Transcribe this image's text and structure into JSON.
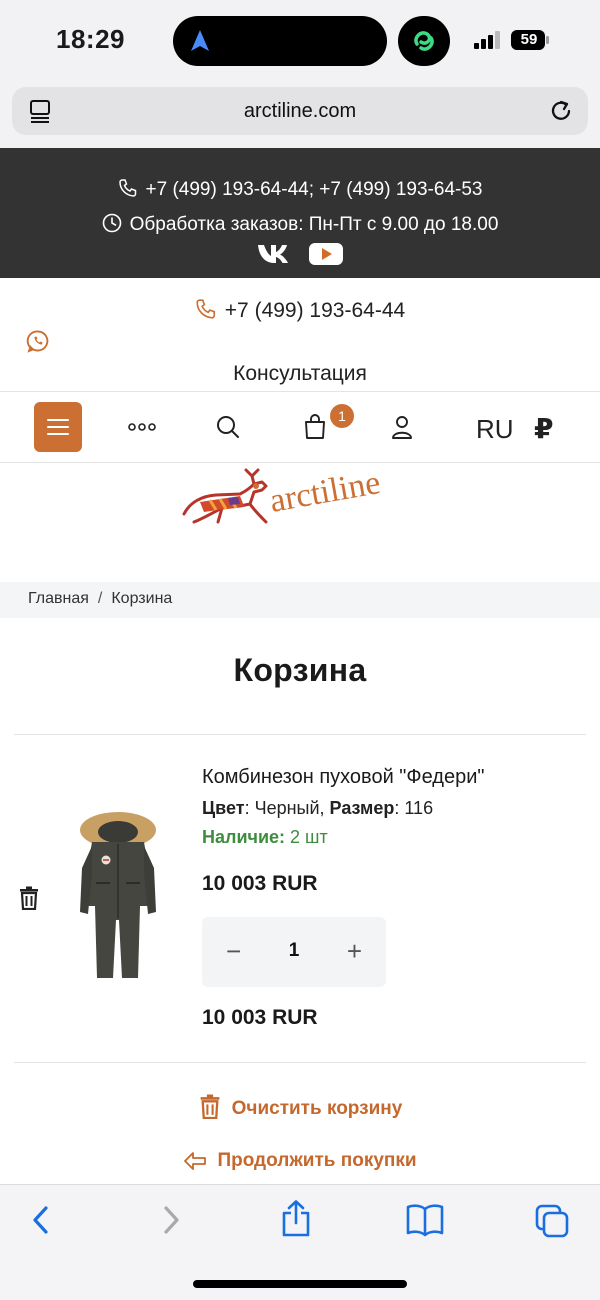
{
  "status_bar": {
    "time": "18:29",
    "battery": "59"
  },
  "browser": {
    "url": "arctiline.com"
  },
  "info_bar": {
    "phones": "+7 (499) 193-64-44; +7 (499) 193-64-53",
    "hours": "Обработка заказов: Пн-Пт с 9.00 до 18.00",
    "socials": [
      "vk-icon",
      "youtube-icon"
    ]
  },
  "header": {
    "phone": "+7 (499) 193-64-44",
    "consultation": "Консультация",
    "cart_count": "1",
    "language": "RU",
    "currency": "₽",
    "logo_text": "arctiline"
  },
  "breadcrumb": {
    "home": "Главная",
    "separator": "/",
    "current": "Корзина"
  },
  "page": {
    "title": "Корзина"
  },
  "cart_item": {
    "name": "Комбинезон пуховой \"Федери\"",
    "color_label": "Цвет",
    "color_value": ": Черный, ",
    "size_label": "Размер",
    "size_value": ": 116",
    "stock_label": "Наличие:",
    "stock_value": " 2 шт",
    "price": "10 003 RUR",
    "quantity": "1",
    "total": "10 003 RUR"
  },
  "actions": {
    "clear_cart": "Очистить корзину",
    "continue_shopping": "Продолжить покупки"
  },
  "colors": {
    "accent": "#cc6f33",
    "stock_green": "#3e8d3e",
    "info_bar_bg": "#333333"
  }
}
